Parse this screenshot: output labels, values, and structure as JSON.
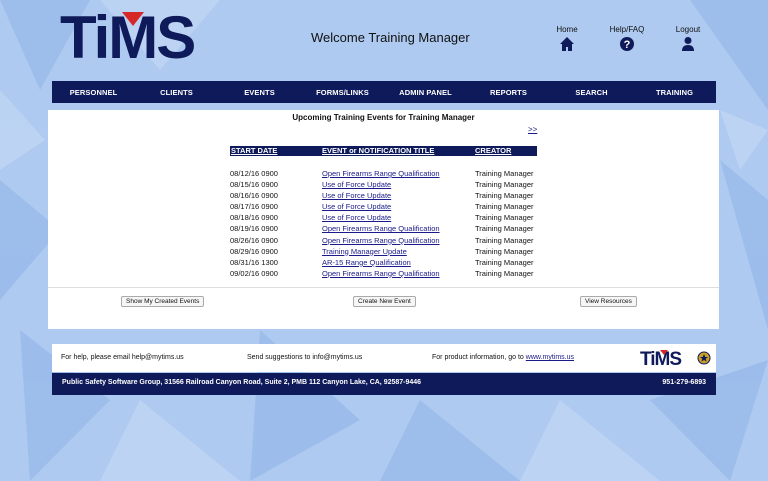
{
  "header": {
    "logo_text": "TiMS",
    "welcome": "Welcome Training Manager",
    "links": {
      "home": "Home",
      "help": "Help/FAQ",
      "logout": "Logout"
    }
  },
  "nav": [
    "PERSONNEL",
    "CLIENTS",
    "EVENTS",
    "FORMS/LINKS",
    "ADMIN PANEL",
    "REPORTS",
    "SEARCH",
    "TRAINING"
  ],
  "main": {
    "title": "Upcoming Training Events for Training Manager",
    "next_link": ">>",
    "columns": {
      "start_date": "START DATE",
      "title": "EVENT or NOTIFICATION TITLE",
      "creator": "CREATOR"
    },
    "events": [
      {
        "date": "08/12/16 0900",
        "title": "Open Firearms Range Qualification",
        "creator": "Training Manager"
      },
      {
        "date": "08/15/16 0900",
        "title": "Use of Force Update",
        "creator": "Training Manager"
      },
      {
        "date": "08/16/16 0900",
        "title": "Use of Force Update",
        "creator": "Training Manager"
      },
      {
        "date": "08/17/16 0900",
        "title": "Use of Force Update",
        "creator": "Training Manager"
      },
      {
        "date": "08/18/16 0900",
        "title": "Use of Force Update",
        "creator": "Training Manager"
      },
      {
        "date": "08/19/16 0900",
        "title": "Open Firearms Range Qualification",
        "creator": "Training Manager"
      },
      {
        "date": "08/26/16 0900",
        "title": "Open Firearms Range Qualification",
        "creator": "Training Manager"
      },
      {
        "date": "08/29/16 0900",
        "title": "Training Manager Update",
        "creator": "Training Manager"
      },
      {
        "date": "08/31/16 1300",
        "title": "AR-15 Range Qualification",
        "creator": "Training Manager"
      },
      {
        "date": "09/02/16 0900",
        "title": "Open Firearms Range Qualification",
        "creator": "Training Manager"
      }
    ],
    "buttons": {
      "created": "Show My Created Events",
      "new_event": "Create New Event",
      "resources": "View Resources"
    }
  },
  "footer": {
    "help": "For help, please email help@mytims.us",
    "suggestions": "Send suggestions to info@mytims.us",
    "product_prefix": "For product information, go to ",
    "product_link": "www.mytims.us",
    "mini_logo_text": "TiMS",
    "address": "Public Safety Software Group, 31566 Railroad Canyon Road, Suite 2, PMB 112 Canyon Lake, CA, 92587-9446",
    "phone": "951-279-6893"
  },
  "colors": {
    "navy": "#0f1a5a",
    "logo_red": "#d62828",
    "background": "#a9c7ee",
    "link": "#1a1a8a"
  }
}
